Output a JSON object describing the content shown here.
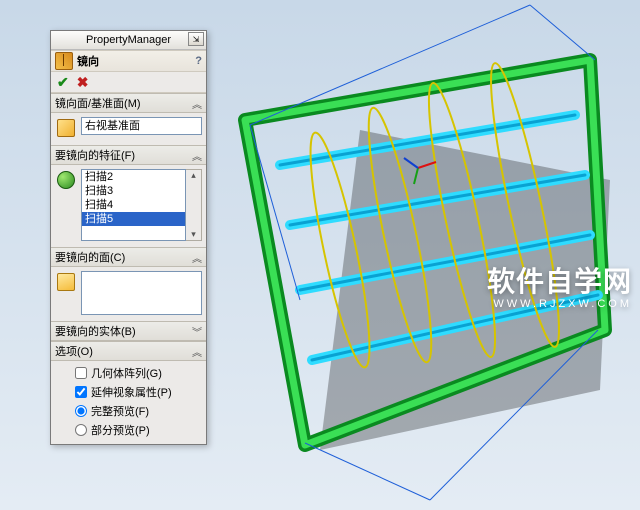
{
  "pm_title": "PropertyManager",
  "feature": {
    "name": "镜向"
  },
  "sections": {
    "mirror_plane": {
      "title": "镜向面/基准面(M)",
      "value": "右视基准面"
    },
    "features": {
      "title": "要镜向的特征(F)",
      "items": [
        "扫描2",
        "扫描3",
        "扫描4",
        "扫描5"
      ],
      "selected_index": 3
    },
    "faces": {
      "title": "要镜向的面(C)"
    },
    "bodies": {
      "title": "要镜向的实体(B)"
    },
    "options": {
      "title": "选项(O)",
      "geometry_pattern": {
        "label": "几何体阵列(G)",
        "checked": false
      },
      "propagate": {
        "label": "延伸视象属性(P)",
        "checked": true
      },
      "full_preview": {
        "label": "完整预览(F)"
      },
      "partial_preview": {
        "label": "部分预览(P)"
      },
      "preview_mode": "full"
    }
  },
  "watermark": {
    "main": "软件自学网",
    "sub": "WWW.RJZXW.COM"
  }
}
